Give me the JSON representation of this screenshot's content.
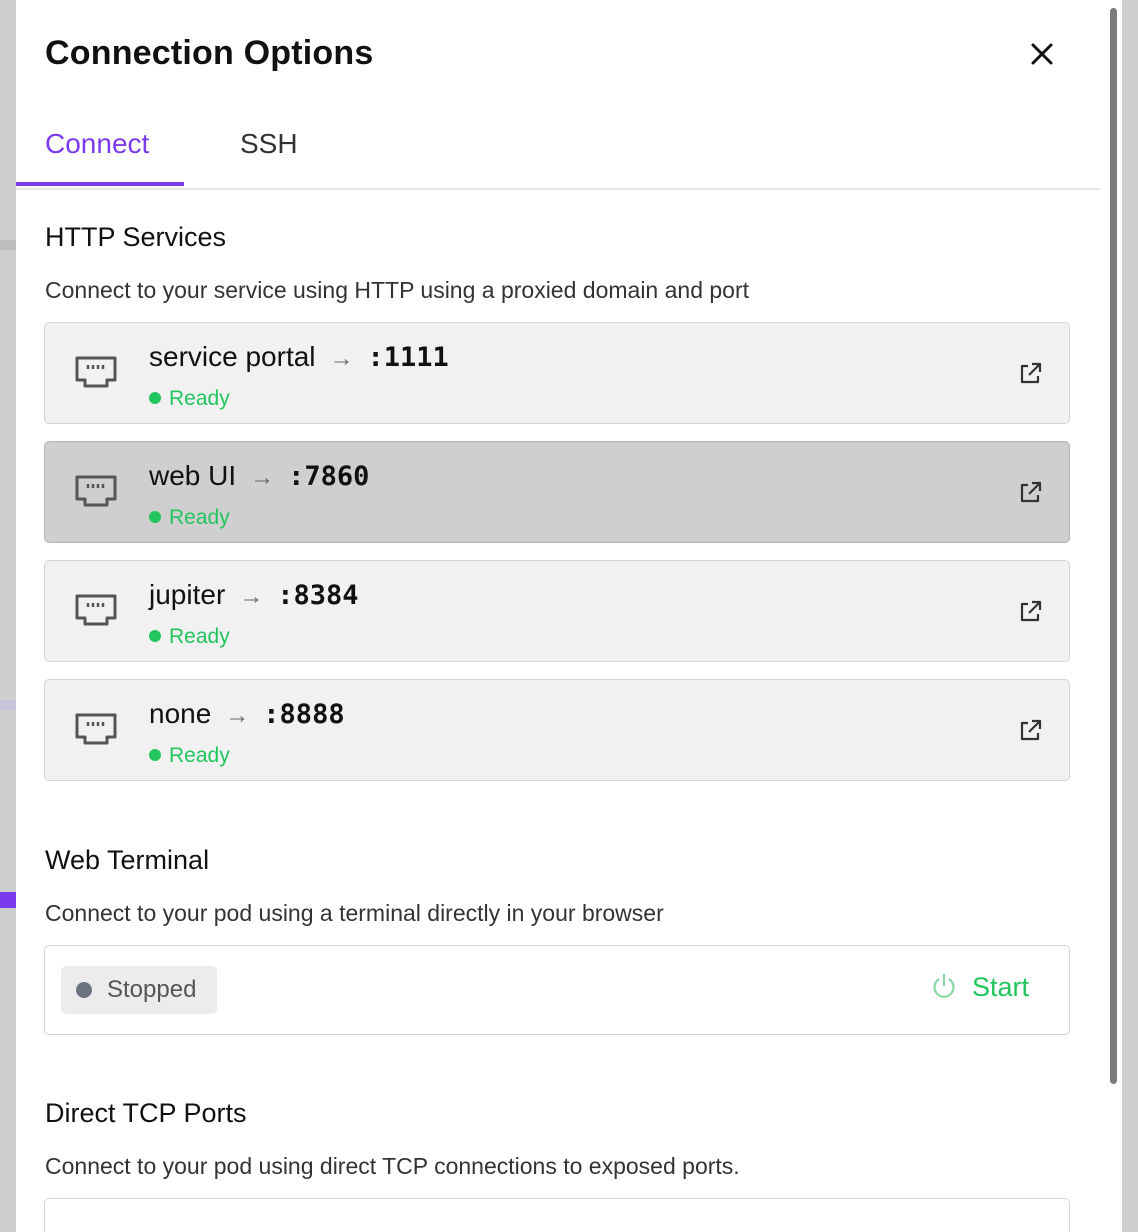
{
  "dialog": {
    "title": "Connection Options",
    "close_icon": "close-icon"
  },
  "tabs": [
    {
      "label": "Connect",
      "active": true
    },
    {
      "label": "SSH",
      "active": false
    }
  ],
  "http_services": {
    "title": "HTTP Services",
    "description": "Connect to your service using HTTP using a proxied domain and port",
    "arrow": "→",
    "items": [
      {
        "name": "service portal",
        "port": ":1111",
        "status": "Ready",
        "icon": "ethernet-port-icon",
        "link_icon": "external-link-icon"
      },
      {
        "name": "web UI",
        "port": ":7860",
        "status": "Ready",
        "icon": "ethernet-port-icon",
        "link_icon": "external-link-icon",
        "hovered": true
      },
      {
        "name": "jupiter",
        "port": ":8384",
        "status": "Ready",
        "icon": "ethernet-port-icon",
        "link_icon": "external-link-icon"
      },
      {
        "name": "none",
        "port": ":8888",
        "status": "Ready",
        "icon": "ethernet-port-icon",
        "link_icon": "external-link-icon"
      }
    ]
  },
  "web_terminal": {
    "title": "Web Terminal",
    "description": "Connect to your pod using a terminal directly in your browser",
    "status": "Stopped",
    "start_label": "Start",
    "start_icon": "power-icon"
  },
  "direct_tcp": {
    "title": "Direct TCP Ports",
    "description": "Connect to your pod using direct TCP connections to exposed ports."
  },
  "colors": {
    "accent": "#7c3aed",
    "ready": "#22c55e",
    "stopped": "#6b7280"
  }
}
